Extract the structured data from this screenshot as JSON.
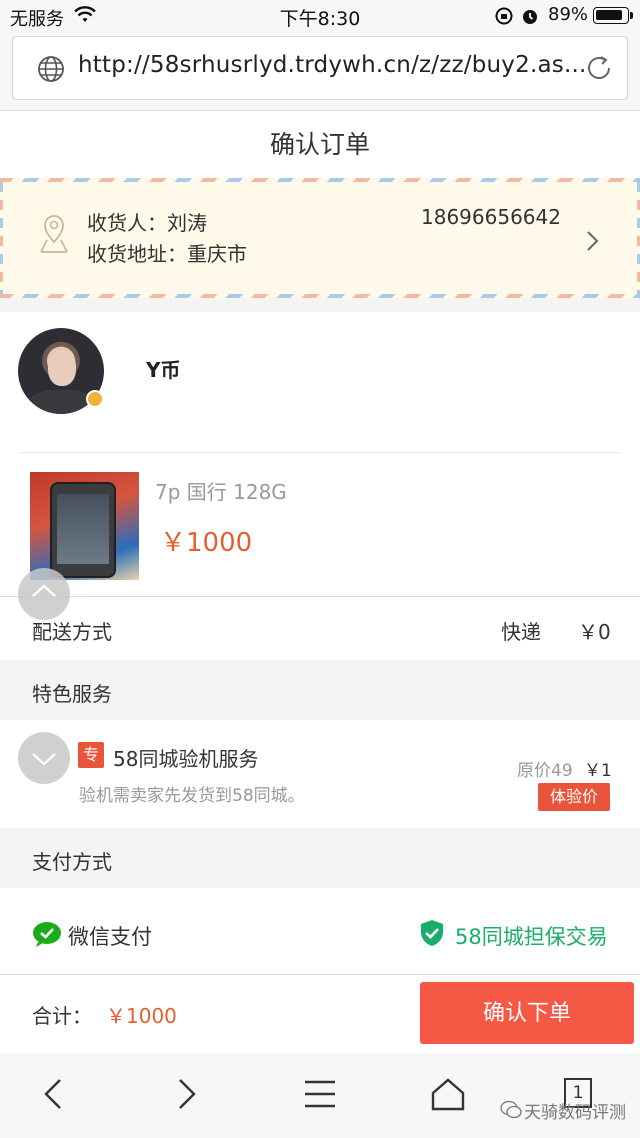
{
  "status_bar": {
    "carrier": "无服务",
    "time": "下午8:30",
    "battery_pct": "89%",
    "battery_level": 0.89
  },
  "browser": {
    "url": "http://58srhusrlyd.trdywh.cn/z/zz/buy2.as..."
  },
  "page": {
    "title": "确认订单"
  },
  "address": {
    "receiver_label": "收货人：",
    "receiver": "刘涛",
    "phone": "18696656642",
    "address_label": "收货地址：",
    "address": "重庆市"
  },
  "seller": {
    "name": "Y币"
  },
  "product": {
    "spec": "7p 国行 128G",
    "price": "￥1000"
  },
  "delivery": {
    "label": "配送方式",
    "method": "快递",
    "fee": "￥0"
  },
  "special_services": {
    "header": "特色服务",
    "tag": "专",
    "title": "58同城验机服务",
    "subtitle": "验机需卖家先发货到58同城。",
    "original_price": "原价49",
    "price": "￥1",
    "badge": "体验价"
  },
  "payment": {
    "header": "支付方式",
    "method": "微信支付",
    "guarantee": "58同城担保交易"
  },
  "footer": {
    "total_label": "合计：",
    "total_value": "￥1000",
    "confirm_label": "确认下单"
  },
  "bottom_nav": {
    "tab_count": "1",
    "watermark": "天骑数码评测"
  },
  "colors": {
    "accent": "#f55844",
    "price": "#e4602f",
    "green": "#1aad6b"
  }
}
